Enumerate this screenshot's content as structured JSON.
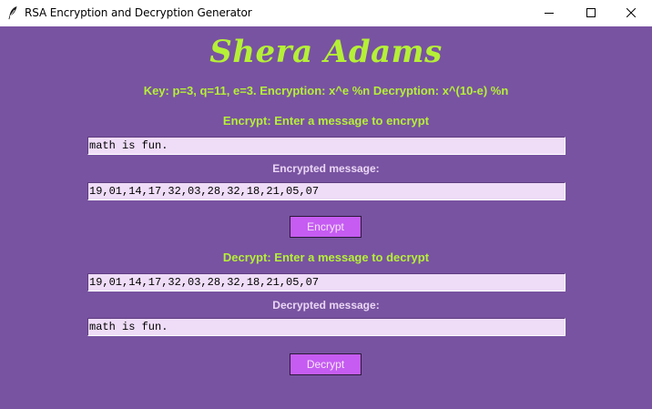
{
  "window": {
    "title": "RSA Encryption and Decryption Generator",
    "icons": {
      "app": "feather-icon",
      "minimize": "minimize-icon",
      "maximize": "maximize-icon",
      "close": "close-icon"
    }
  },
  "colors": {
    "background": "#7853a1",
    "accent": "#b5f037",
    "label": "#ead6f4",
    "field_bg": "#efdcf7",
    "button_bg": "#c65cf2"
  },
  "header": {
    "name": "Shera Adams",
    "key_info": "Key: p=3, q=11, e=3. Encryption: x^e %n Decryption: x^(10-e) %n"
  },
  "encrypt": {
    "prompt": "Encrypt: Enter a message to encrypt",
    "input_value": "math is fun.",
    "result_label": "Encrypted message:",
    "result_value": "19,01,14,17,32,03,28,32,18,21,05,07",
    "button_label": "Encrypt"
  },
  "decrypt": {
    "prompt": "Decrypt: Enter a message to decrypt",
    "input_value": "19,01,14,17,32,03,28,32,18,21,05,07",
    "result_label": "Decrypted message:",
    "result_value": "math is fun.",
    "button_label": "Decrypt"
  }
}
